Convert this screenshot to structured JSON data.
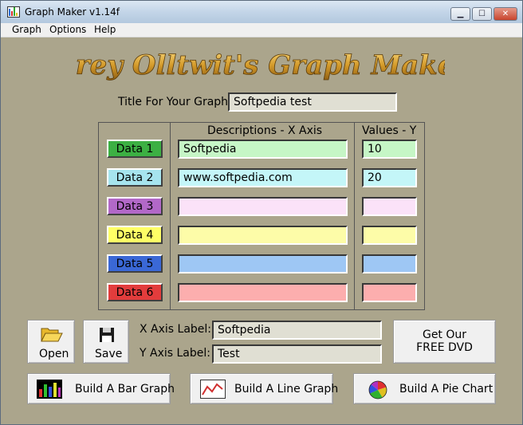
{
  "window": {
    "title": "Graph Maker v1.14f",
    "controls": {
      "minimize": "▁",
      "maximize": "☐",
      "close": "✕"
    },
    "menu": [
      "Graph",
      "Options",
      "Help"
    ]
  },
  "logo_text": "Grey Olltwit's Graph Maker",
  "graph_title": {
    "label": "Title For Your Graph:",
    "value": "Softpedia test"
  },
  "table": {
    "header_desc": "Descriptions - X Axis",
    "header_values": "Values - Y",
    "rows": [
      {
        "button": "Data 1",
        "color": "#3cb043",
        "field_color": "#c6f6c6",
        "description": "Softpedia",
        "value": "10"
      },
      {
        "button": "Data 2",
        "color": "#a6e4ee",
        "field_color": "#c4f6f8",
        "description": "www.softpedia.com",
        "value": "20"
      },
      {
        "button": "Data 3",
        "color": "#b268c8",
        "field_color": "#fbe2f8",
        "description": "",
        "value": ""
      },
      {
        "button": "Data 4",
        "color": "#ffff66",
        "field_color": "#fdfca8",
        "description": "",
        "value": ""
      },
      {
        "button": "Data 5",
        "color": "#3a68d6",
        "field_color": "#9ec7f4",
        "description": "",
        "value": ""
      },
      {
        "button": "Data 6",
        "color": "#e23c3c",
        "field_color": "#fcaeae",
        "description": "",
        "value": ""
      }
    ]
  },
  "file_buttons": {
    "open": "Open",
    "save": "Save"
  },
  "axis_labels": {
    "x_label": "X Axis Label:",
    "x_value": "Softpedia",
    "y_label": "Y Axis Label:",
    "y_value": "Test"
  },
  "dvd_button": {
    "line1": "Get Our",
    "line2": "FREE DVD"
  },
  "build_buttons": {
    "bar": "Build A Bar Graph",
    "line": "Build A Line Graph",
    "pie": "Build A Pie Chart"
  },
  "icons": {
    "app": "graph-icon",
    "open": "folder-open-icon",
    "save": "floppy-disk-icon",
    "bar": "bar-chart-icon",
    "line": "line-chart-icon",
    "pie": "pie-chart-icon"
  }
}
